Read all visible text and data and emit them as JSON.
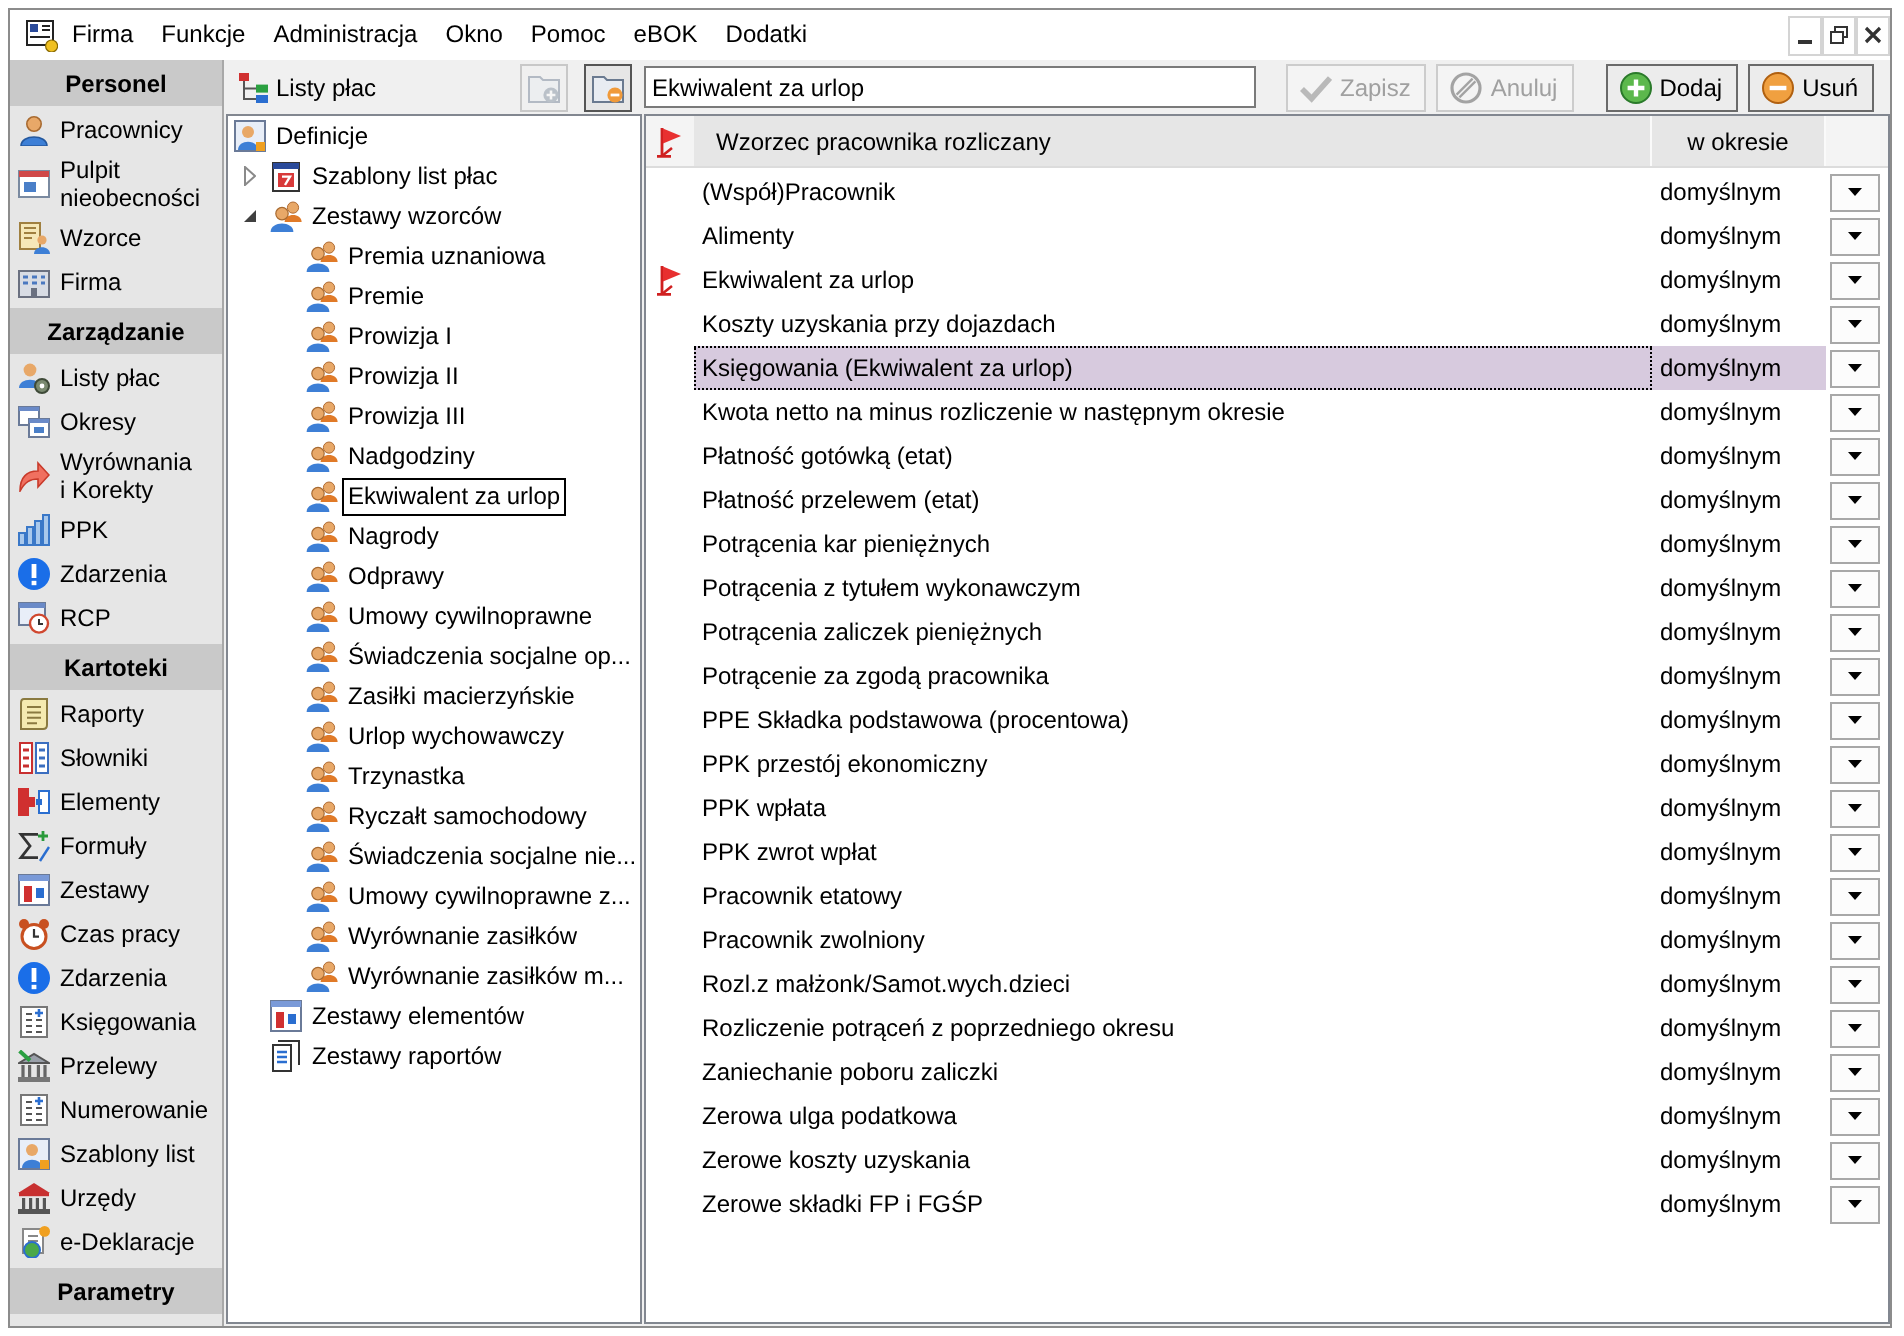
{
  "menu_bar": {
    "items": [
      "Firma",
      "Funkcje",
      "Administracja",
      "Okno",
      "Pomoc",
      "eBOK",
      "Dodatki"
    ]
  },
  "sidebar": {
    "sections": [
      {
        "title": "Personel",
        "items": [
          {
            "label": "Pracownicy",
            "kind": "person"
          },
          {
            "label": "Pulpit\nnieobecności",
            "kind": "absence"
          },
          {
            "label": "Wzorce",
            "kind": "templates"
          },
          {
            "label": "Firma",
            "kind": "company"
          }
        ]
      },
      {
        "title": "Zarządzanie",
        "items": [
          {
            "label": "Listy płac",
            "kind": "payroll"
          },
          {
            "label": "Okresy",
            "kind": "periods"
          },
          {
            "label": "Wyrównania\ni Korekty",
            "kind": "corrections"
          },
          {
            "label": "PPK",
            "kind": "ppk"
          },
          {
            "label": "Zdarzenia",
            "kind": "events"
          },
          {
            "label": "RCP",
            "kind": "rcp"
          }
        ]
      },
      {
        "title": "Kartoteki",
        "items": [
          {
            "label": "Raporty",
            "kind": "reports"
          },
          {
            "label": "Słowniki",
            "kind": "dictionaries"
          },
          {
            "label": "Elementy",
            "kind": "elements"
          },
          {
            "label": "Formuły",
            "kind": "formulas"
          },
          {
            "label": "Zestawy",
            "kind": "sets"
          },
          {
            "label": "Czas pracy",
            "kind": "worktime"
          },
          {
            "label": "Zdarzenia",
            "kind": "events"
          },
          {
            "label": "Księgowania",
            "kind": "ledger"
          },
          {
            "label": "Przelewy",
            "kind": "transfers"
          },
          {
            "label": "Numerowanie",
            "kind": "ledger"
          },
          {
            "label": "Szablony list",
            "kind": "card"
          },
          {
            "label": "Urzędy",
            "kind": "offices"
          },
          {
            "label": "e-Deklaracje",
            "kind": "declarations"
          }
        ]
      },
      {
        "title": "Parametry"
      }
    ]
  },
  "tree_panel": {
    "title": "Listy płac",
    "buttons": [
      {
        "kind": "add",
        "disabled": true
      },
      {
        "kind": "remove",
        "disabled": false
      }
    ],
    "tree": [
      {
        "label": "Definicje",
        "kind": "card",
        "selected": false,
        "children": [
          {
            "label": "Szablony list płac",
            "kind": "calendar",
            "expanded": false,
            "selected": false
          },
          {
            "label": "Zestawy wzorców",
            "kind": "group",
            "expanded": true,
            "selected": false,
            "children": [
              {
                "label": "Premia uznaniowa",
                "kind": "group",
                "selected": false
              },
              {
                "label": "Premie",
                "kind": "group",
                "selected": false
              },
              {
                "label": "Prowizja I",
                "kind": "group",
                "selected": false
              },
              {
                "label": "Prowizja II",
                "kind": "group",
                "selected": false
              },
              {
                "label": "Prowizja III",
                "kind": "group",
                "selected": false
              },
              {
                "label": "Nadgodziny",
                "kind": "group",
                "selected": false
              },
              {
                "label": "Ekwiwalent za urlop",
                "kind": "group",
                "selected": true
              },
              {
                "label": "Nagrody",
                "kind": "group",
                "selected": false
              },
              {
                "label": "Odprawy",
                "kind": "group",
                "selected": false
              },
              {
                "label": "Umowy cywilnoprawne",
                "kind": "group",
                "selected": false
              },
              {
                "label": "Świadczenia socjalne op...",
                "kind": "group",
                "selected": false
              },
              {
                "label": "Zasiłki macierzyńskie",
                "kind": "group",
                "selected": false
              },
              {
                "label": "Urlop wychowawczy",
                "kind": "group",
                "selected": false
              },
              {
                "label": "Trzynastka",
                "kind": "group",
                "selected": false
              },
              {
                "label": "Ryczałt samochodowy",
                "kind": "group",
                "selected": false
              },
              {
                "label": "Świadczenia socjalne nie...",
                "kind": "group",
                "selected": false
              },
              {
                "label": "Umowy cywilnoprawne z...",
                "kind": "group",
                "selected": false
              },
              {
                "label": "Wyrównanie zasiłków",
                "kind": "group",
                "selected": false
              },
              {
                "label": "Wyrównanie zasiłków m...",
                "kind": "group",
                "selected": false
              }
            ]
          },
          {
            "label": "Zestawy elementów",
            "kind": "sets",
            "selected": false
          },
          {
            "label": "Zestawy raportów",
            "kind": "document",
            "selected": false
          }
        ]
      }
    ]
  },
  "editor": {
    "name_field": {
      "value": "Ekwiwalent za urlop"
    },
    "button_groups": [
      {
        "buttons": [
          {
            "label": "Zapisz",
            "kind": "save",
            "disabled": true
          },
          {
            "label": "Anuluj",
            "kind": "cancel",
            "disabled": true
          }
        ]
      },
      {
        "buttons": [
          {
            "label": "Dodaj",
            "kind": "add",
            "disabled": false
          },
          {
            "label": "Usuń",
            "kind": "remove",
            "disabled": false
          }
        ]
      }
    ]
  },
  "table": {
    "columns": [
      {
        "label": "Wzorzec pracownika rozliczany"
      },
      {
        "label": "w okresie"
      }
    ],
    "rows": [
      {
        "name": "(Współ)Pracownik",
        "period": "domyślnym",
        "flag": false,
        "selected": false
      },
      {
        "name": "Alimenty",
        "period": "domyślnym",
        "flag": false,
        "selected": false
      },
      {
        "name": "Ekwiwalent za urlop",
        "period": "domyślnym",
        "flag": true,
        "selected": false
      },
      {
        "name": "Koszty uzyskania przy dojazdach",
        "period": "domyślnym",
        "flag": false,
        "selected": false
      },
      {
        "name": "Księgowania (Ekwiwalent za urlop)",
        "period": "domyślnym",
        "flag": false,
        "selected": true
      },
      {
        "name": "Kwota netto na minus rozliczenie w następnym okresie",
        "period": "domyślnym",
        "flag": false,
        "selected": false
      },
      {
        "name": "Płatność gotówką (etat)",
        "period": "domyślnym",
        "flag": false,
        "selected": false
      },
      {
        "name": "Płatność przelewem (etat)",
        "period": "domyślnym",
        "flag": false,
        "selected": false
      },
      {
        "name": "Potrącenia kar pieniężnych",
        "period": "domyślnym",
        "flag": false,
        "selected": false
      },
      {
        "name": "Potrącenia z tytułem wykonawczym",
        "period": "domyślnym",
        "flag": false,
        "selected": false
      },
      {
        "name": "Potrącenia zaliczek pieniężnych",
        "period": "domyślnym",
        "flag": false,
        "selected": false
      },
      {
        "name": "Potrącenie za zgodą pracownika",
        "period": "domyślnym",
        "flag": false,
        "selected": false
      },
      {
        "name": "PPE Składka podstawowa (procentowa)",
        "period": "domyślnym",
        "flag": false,
        "selected": false
      },
      {
        "name": "PPK przestój ekonomiczny",
        "period": "domyślnym",
        "flag": false,
        "selected": false
      },
      {
        "name": "PPK wpłata",
        "period": "domyślnym",
        "flag": false,
        "selected": false
      },
      {
        "name": "PPK zwrot wpłat",
        "period": "domyślnym",
        "flag": false,
        "selected": false
      },
      {
        "name": "Pracownik etatowy",
        "period": "domyślnym",
        "flag": false,
        "selected": false
      },
      {
        "name": "Pracownik zwolniony",
        "period": "domyślnym",
        "flag": false,
        "selected": false
      },
      {
        "name": "Rozl.z małżonk/Samot.wych.dzieci",
        "period": "domyślnym",
        "flag": false,
        "selected": false
      },
      {
        "name": "Rozliczenie potrąceń z poprzedniego okresu",
        "period": "domyślnym",
        "flag": false,
        "selected": false
      },
      {
        "name": "Zaniechanie poboru zaliczki",
        "period": "domyślnym",
        "flag": false,
        "selected": false
      },
      {
        "name": "Zerowa ulga podatkowa",
        "period": "domyślnym",
        "flag": false,
        "selected": false
      },
      {
        "name": "Zerowe koszty uzyskania",
        "period": "domyślnym",
        "flag": false,
        "selected": false
      },
      {
        "name": "Zerowe składki FP i FGŚP",
        "period": "domyślnym",
        "flag": false,
        "selected": false
      }
    ]
  }
}
